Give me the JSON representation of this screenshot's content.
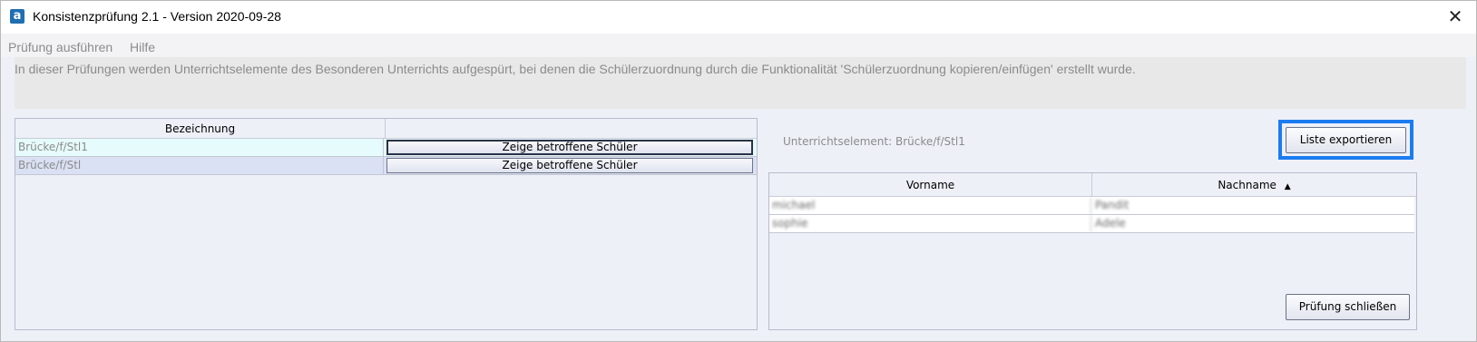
{
  "window": {
    "title": "Konsistenzprüfung 2.1 - Version 2020-09-28",
    "app_icon_letter": "a",
    "close_symbol": "✕"
  },
  "menu": {
    "items": [
      "Prüfung ausführen",
      "Hilfe"
    ]
  },
  "info": {
    "text": "In dieser Prüfungen werden Unterrichtselemente des Besonderen Unterrichts aufgespürt, bei denen die Schülerzuordnung durch die Funktionalität 'Schülerzuordnung kopieren/einfügen' erstellt wurde."
  },
  "left_table": {
    "columns": [
      "Bezeichnung",
      ""
    ],
    "rows": [
      {
        "bezeichnung": "Brücke/f/Stl1",
        "button": "Zeige betroffene Schüler"
      },
      {
        "bezeichnung": "Brücke/f/Stl",
        "button": "Zeige betroffene Schüler"
      }
    ]
  },
  "right_panel": {
    "unterrichtselement_label": "Unterrichtselement: Brücke/f/Stl1",
    "export_button": "Liste exportieren",
    "close_button": "Prüfung schließen",
    "columns": [
      "Vorname",
      "Nachname"
    ],
    "sort_indicator": "▲",
    "rows": [
      {
        "vorname": "michael",
        "nachname": "Pandit"
      },
      {
        "vorname": "sophie",
        "nachname": "Adele"
      }
    ]
  },
  "colors": {
    "selected_row": "#e6fbfb",
    "second_row": "#dbe1f4",
    "highlight": "#1b7cf0"
  }
}
